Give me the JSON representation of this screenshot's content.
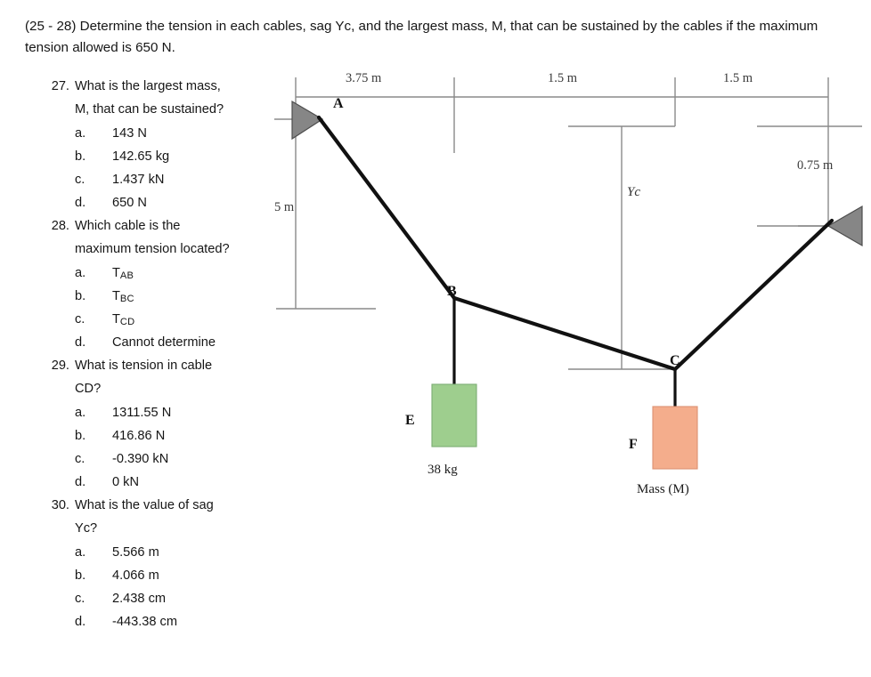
{
  "prompt": "(25 - 28) Determine the tension in each cables, sag Yc, and the largest mass, M, that can be sustained by the cables if the maximum tension allowed is 650 N.",
  "questions": [
    {
      "number": "27.",
      "text_line1": "What is the largest mass,",
      "text_line2": "M, that can be sustained?",
      "options": [
        {
          "letter": "a.",
          "value": "143 N"
        },
        {
          "letter": "b.",
          "value": "142.65 kg"
        },
        {
          "letter": "c.",
          "value": "1.437 kN"
        },
        {
          "letter": "d.",
          "value": "650 N"
        }
      ]
    },
    {
      "number": "28.",
      "text_line1": "Which cable is the",
      "text_line2": "maximum tension located?",
      "options": [
        {
          "letter": "a.",
          "value": "T",
          "sub": "AB"
        },
        {
          "letter": "b.",
          "value": "T",
          "sub": "BC"
        },
        {
          "letter": "c.",
          "value": "T",
          "sub": "CD"
        },
        {
          "letter": "d.",
          "value": "Cannot determine",
          "sub": ""
        }
      ]
    },
    {
      "number": "29.",
      "text_line1": "What is tension in cable",
      "text_line2": "CD?",
      "options": [
        {
          "letter": "a.",
          "value": "1311.55 N"
        },
        {
          "letter": "b.",
          "value": "416.86 N"
        },
        {
          "letter": "c.",
          "value": "-0.390 kN"
        },
        {
          "letter": "d.",
          "value": "0 kN"
        }
      ]
    },
    {
      "number": "30.",
      "text_line1": "What is the value of sag",
      "text_line2": "Yc?",
      "options": [
        {
          "letter": "a.",
          "value": "5.566 m"
        },
        {
          "letter": "b.",
          "value": "4.066 m"
        },
        {
          "letter": "c.",
          "value": "2.438 cm"
        },
        {
          "letter": "d.",
          "value": "-443.38 cm"
        }
      ]
    }
  ],
  "diagram": {
    "dimensions": {
      "span_ab": "3.75 m",
      "span_bc": "1.5 m",
      "span_cd": "1.5 m",
      "drop_a": "5 m",
      "drop_d": "0.75 m",
      "sag_label": "Yc"
    },
    "points": {
      "a": "A",
      "b": "B",
      "c": "C",
      "e": "E",
      "f": "F"
    },
    "masses": {
      "e_value": "38 kg",
      "f_value": "Mass (M)"
    },
    "colors": {
      "block_e_fill": "#9ece8e",
      "block_e_stroke": "#7cae74",
      "block_f_fill": "#f4ad8c",
      "block_f_stroke": "#dc9272",
      "support_fill": "#868686",
      "support_stroke": "#4d4d4d",
      "cable": "#111111",
      "dimension_line": "#8a8a8a"
    }
  }
}
